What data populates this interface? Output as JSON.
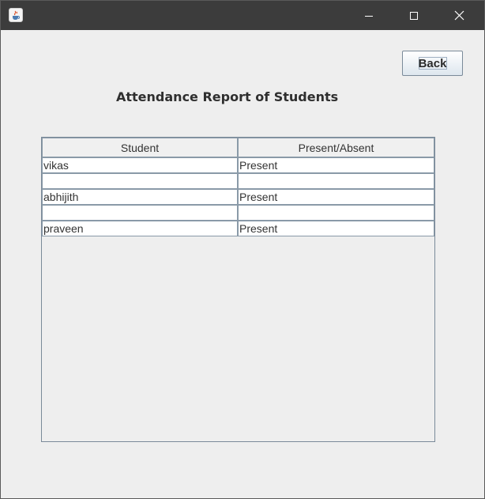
{
  "window": {
    "icon": "java-cup-icon",
    "controls": [
      "minimize-icon",
      "maximize-icon",
      "close-icon"
    ]
  },
  "toolbar": {
    "back_label": "Back"
  },
  "report": {
    "title": "Attendance Report of Students"
  },
  "table": {
    "columns": [
      "Student",
      "Present/Absent"
    ],
    "rows": [
      [
        "vikas",
        "Present"
      ],
      [
        "",
        ""
      ],
      [
        "abhijith",
        "Present"
      ],
      [
        "",
        ""
      ],
      [
        "praveen",
        "Present"
      ]
    ]
  }
}
